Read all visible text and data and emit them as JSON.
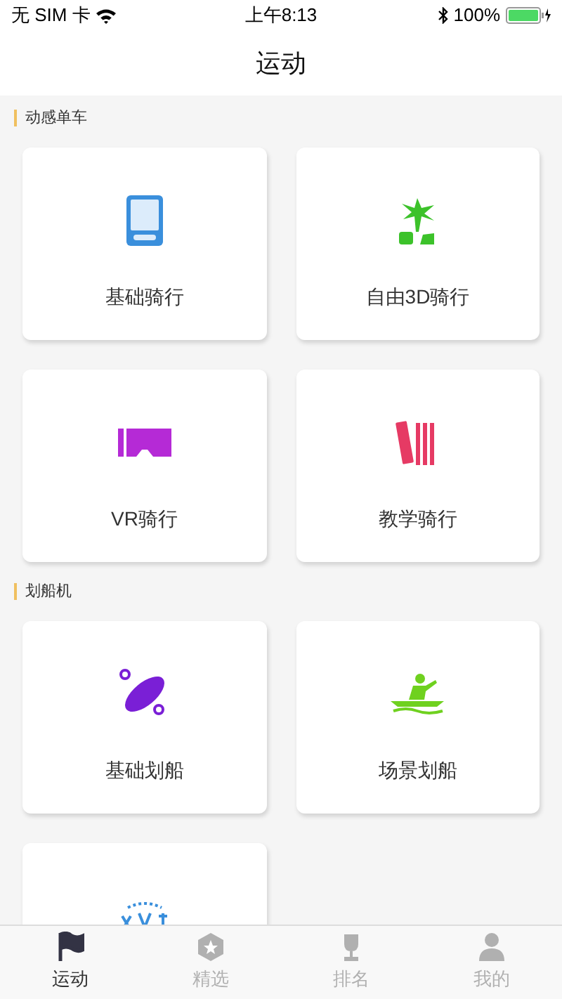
{
  "status_bar": {
    "carrier": "无 SIM 卡",
    "time": "上午8:13",
    "battery": "100%"
  },
  "title": "运动",
  "sections": [
    {
      "title": "动感单车",
      "items": [
        {
          "kind": "meter",
          "label": "基础骑行"
        },
        {
          "kind": "palm",
          "label": "自由3D骑行"
        },
        {
          "kind": "vr",
          "label": "VR骑行"
        },
        {
          "kind": "books",
          "label": "教学骑行"
        }
      ]
    },
    {
      "title": "划船机",
      "items": [
        {
          "kind": "kayak",
          "label": "基础划船"
        },
        {
          "kind": "rower",
          "label": "场景划船"
        },
        {
          "kind": "badge"
        }
      ]
    }
  ],
  "tabs": [
    {
      "kind": "flag",
      "label": "运动",
      "selected": true
    },
    {
      "kind": "star",
      "label": "精选",
      "selected": false
    },
    {
      "kind": "trophy",
      "label": "排名",
      "selected": false
    },
    {
      "kind": "person",
      "label": "我的",
      "selected": false
    }
  ]
}
